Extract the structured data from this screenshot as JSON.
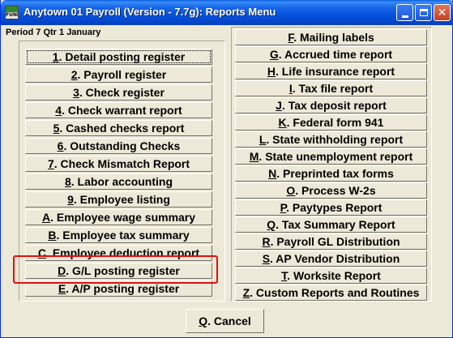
{
  "window": {
    "title": "Anytown 01 Payroll (Version - 7.7g):  Reports Menu",
    "icon_label": "FUND"
  },
  "period": "Period 7 Qtr 1 January",
  "left_menu": [
    {
      "key": "1",
      "label": ". Detail posting register"
    },
    {
      "key": "2",
      "label": ".  Payroll register"
    },
    {
      "key": "3",
      "label": ". Check register"
    },
    {
      "key": "4",
      "label": ". Check warrant report"
    },
    {
      "key": "5",
      "label": ". Cashed checks report"
    },
    {
      "key": "6",
      "label": ". Outstanding Checks"
    },
    {
      "key": "7",
      "label": ". Check Mismatch Report"
    },
    {
      "key": "8",
      "label": ". Labor accounting"
    },
    {
      "key": "9",
      "label": ".  Employee listing"
    },
    {
      "key": "A",
      "label": ". Employee wage summary"
    },
    {
      "key": "B",
      "label": ". Employee tax summary"
    },
    {
      "key": "C",
      "label": ". Employee deduction report"
    },
    {
      "key": "D",
      "label": ". G/L posting register"
    },
    {
      "key": "E",
      "label": ". A/P posting register"
    }
  ],
  "right_menu": [
    {
      "key": "F",
      "label": ".  Mailing labels"
    },
    {
      "key": "G",
      "label": ". Accrued time report"
    },
    {
      "key": "H",
      "label": ". Life insurance report"
    },
    {
      "key": "I",
      "label": ". Tax file report"
    },
    {
      "key": "J",
      "label": ". Tax deposit report"
    },
    {
      "key": "K",
      "label": ". Federal form 941"
    },
    {
      "key": "L",
      "label": ". State withholding report"
    },
    {
      "key": "M",
      "label": ". State unemployment report"
    },
    {
      "key": "N",
      "label": ". Preprinted tax forms"
    },
    {
      "key": "O",
      "label": ". Process W-2s"
    },
    {
      "key": "P",
      "label": ".  Paytypes Report"
    },
    {
      "key": "Q",
      "label": ". Tax Summary Report"
    },
    {
      "key": "R",
      "label": ". Payroll GL Distribution"
    },
    {
      "key": "S",
      "label": ". AP Vendor Distribution"
    },
    {
      "key": "T",
      "label": ". Worksite Report"
    },
    {
      "key": "Z",
      "label": ". Custom Reports and Routines"
    }
  ],
  "cancel": {
    "key": "Q",
    "label": ". Cancel"
  },
  "colors": {
    "highlight": "#e01010",
    "titlebar": "#0653dd"
  }
}
